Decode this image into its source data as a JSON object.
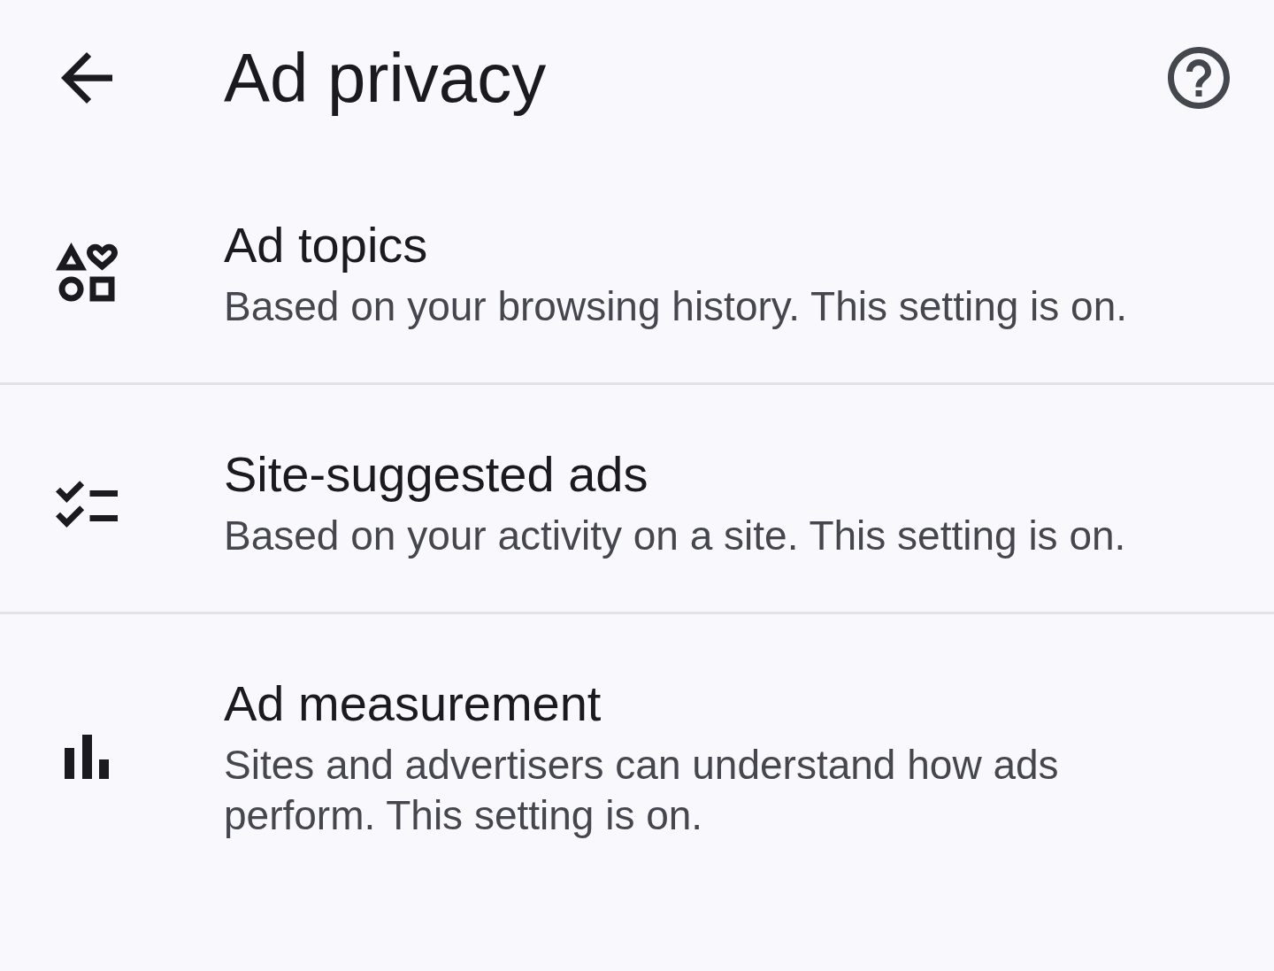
{
  "header": {
    "title": "Ad privacy"
  },
  "items": [
    {
      "title": "Ad topics",
      "description": "Based on your browsing history. This setting is on."
    },
    {
      "title": "Site-suggested ads",
      "description": "Based on your activity on a site. This setting is on."
    },
    {
      "title": "Ad measurement",
      "description": "Sites and advertisers can understand how ads perform. This setting is on."
    }
  ]
}
